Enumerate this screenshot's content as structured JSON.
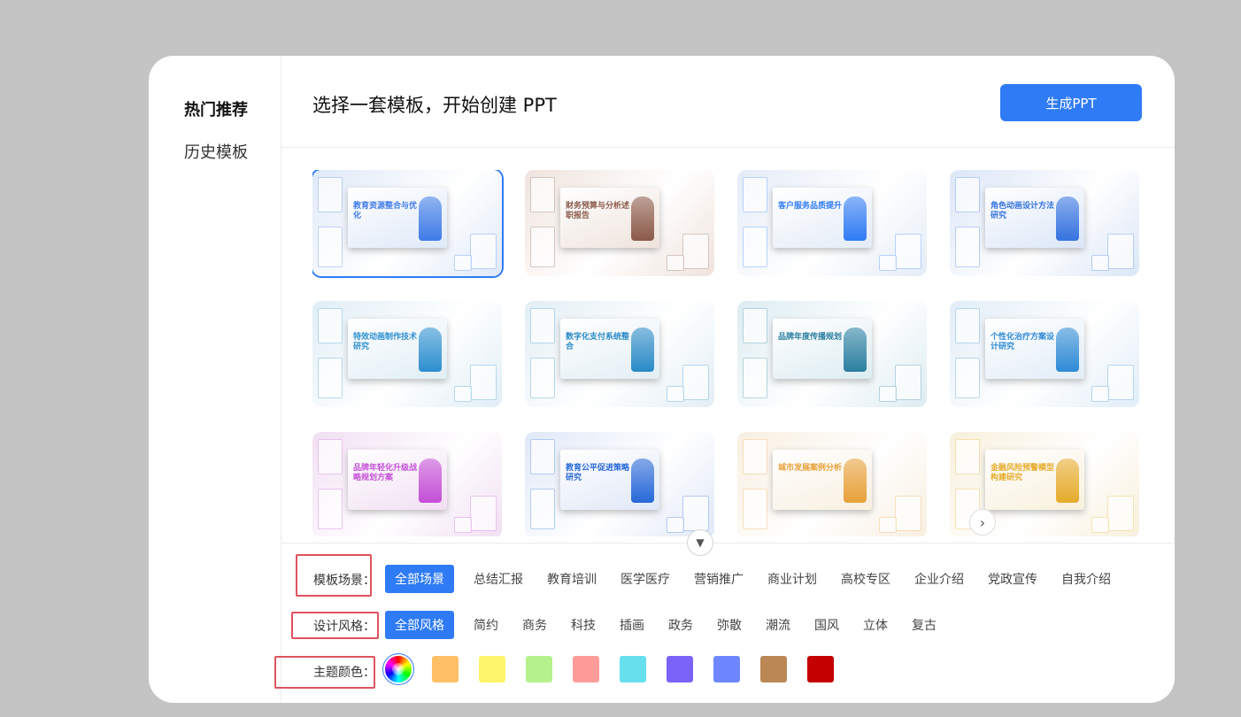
{
  "sidebar": {
    "items": [
      {
        "label": "热门推荐",
        "active": true
      },
      {
        "label": "历史模板",
        "active": false
      }
    ]
  },
  "header": {
    "title": "选择一套模板，开始创建 PPT",
    "generate_label": "生成PPT"
  },
  "templates": [
    {
      "title": "教育资源整合与优化",
      "theme": "#3f7be8",
      "bg": "#dfe9f8",
      "selected": true
    },
    {
      "title": "财务预算与分析述职报告",
      "theme": "#8b5a4a",
      "bg": "#efe3dc",
      "selected": false
    },
    {
      "title": "客户服务品质提升",
      "theme": "#2f7bf5",
      "bg": "#e4ecf7",
      "selected": false
    },
    {
      "title": "角色动画设计方法研究",
      "theme": "#3573e0",
      "bg": "#dbe6f7",
      "selected": false
    },
    {
      "title": "特效动画制作技术研究",
      "theme": "#2d8fd0",
      "bg": "#e0eef6",
      "selected": false
    },
    {
      "title": "数字化支付系统整合",
      "theme": "#2a8ac7",
      "bg": "#e2eef5",
      "selected": false
    },
    {
      "title": "品牌年度传播规划",
      "theme": "#2b7fa0",
      "bg": "#dcecf2",
      "selected": false
    },
    {
      "title": "个性化治疗方案设计研究",
      "theme": "#2f8ad6",
      "bg": "#e1edf7",
      "selected": false
    },
    {
      "title": "品牌年轻化升级战略规划方案",
      "theme": "#c44fd6",
      "bg": "#f1dff3",
      "selected": false
    },
    {
      "title": "教育公平促进策略研究",
      "theme": "#2768d8",
      "bg": "#e0e8f7",
      "selected": false
    },
    {
      "title": "城市发展案例分析",
      "theme": "#e8a13a",
      "bg": "#f8efe0",
      "selected": false
    },
    {
      "title": "金融风险预警模型构建研究",
      "theme": "#e6ab2b",
      "bg": "#f8f0dc",
      "selected": false
    }
  ],
  "filters": {
    "scene": {
      "label": "模板场景：",
      "options": [
        "全部场景",
        "总结汇报",
        "教育培训",
        "医学医疗",
        "营销推广",
        "商业计划",
        "高校专区",
        "企业介绍",
        "党政宣传",
        "自我介绍"
      ],
      "selected": "全部场景"
    },
    "style": {
      "label": "设计风格：",
      "options": [
        "全部风格",
        "简约",
        "商务",
        "科技",
        "插画",
        "政务",
        "弥散",
        "潮流",
        "国风",
        "立体",
        "复古"
      ],
      "selected": "全部风格"
    },
    "color": {
      "label": "主题颜色：",
      "swatches": [
        "rainbow",
        "#ffbf66",
        "#fef56a",
        "#b5f28c",
        "#fe9c9a",
        "#67e0ee",
        "#7b63f9",
        "#6e87fe",
        "#ba8755",
        "#c40000"
      ]
    }
  },
  "icons": {
    "collapse": "chevron-down-icon",
    "scroll": "chevron-right-icon",
    "all_colors": "color-wheel-icon"
  }
}
